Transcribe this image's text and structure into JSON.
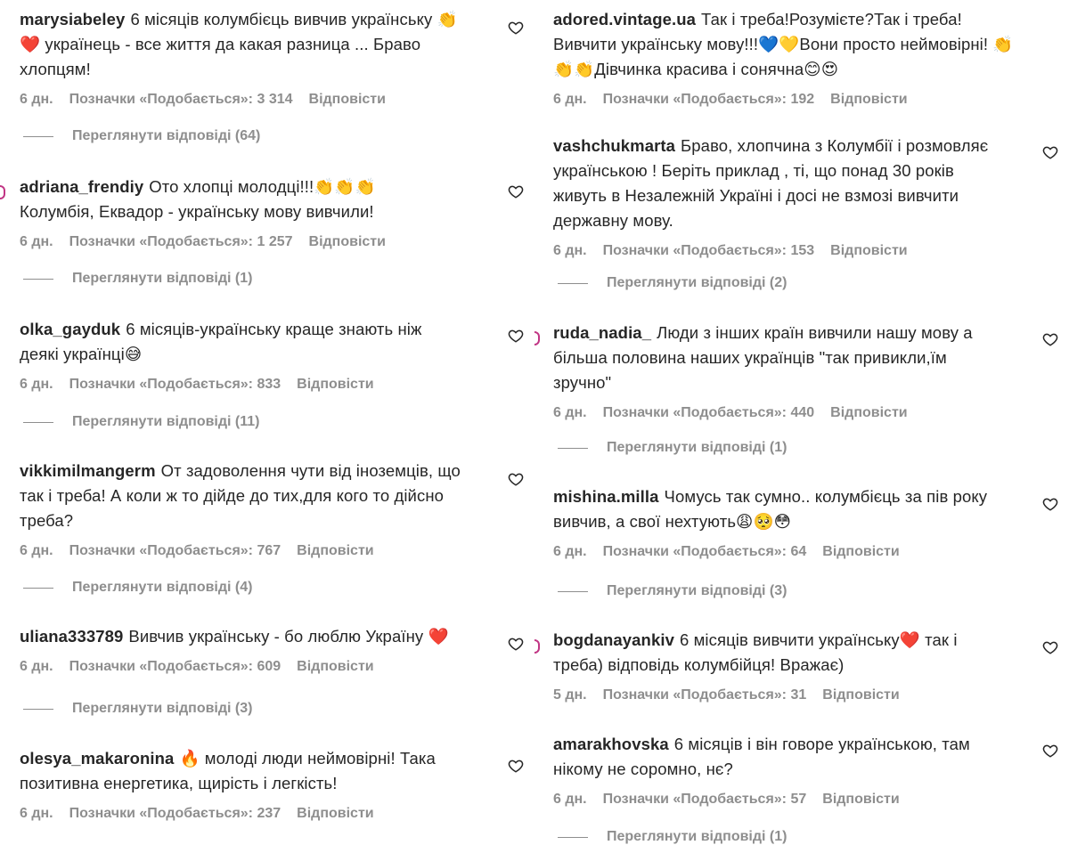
{
  "common": {
    "likes_prefix": "Позначки «Подобається»:",
    "reply_label": "Відповісти",
    "view_replies_prefix": "Переглянути відповіді"
  },
  "left": [
    {
      "username": "marysiabeley",
      "text": "6 місяців колумбієць вивчив українську 👏 ❤️ українець - все життя да какая разница ... Браво хлопцям!",
      "time": "6 дн.",
      "likes": "3 314",
      "replies": "(64)"
    },
    {
      "username": "adriana_frendiy",
      "text": "Ото хлопці молодці!!!👏👏👏 Колумбія, Еквадор - українську мову вивчили!",
      "time": "6 дн.",
      "likes": "1 257",
      "replies": "(1)"
    },
    {
      "username": "olka_gayduk",
      "text": "6 місяців-українську краще знають ніж деякі українці😅",
      "time": "6 дн.",
      "likes": "833",
      "replies": "(11)"
    },
    {
      "username": "vikkimilmangerm",
      "text": "От задоволення чути від іноземців, що так і треба! А коли ж то дійде до тих,для кого то дійсно треба?",
      "time": "6 дн.",
      "likes": "767",
      "replies": "(4)"
    },
    {
      "username": "uliana333789",
      "text": "Вивчив українську - бо люблю Україну ❤️",
      "time": "6 дн.",
      "likes": "609",
      "replies": "(3)"
    },
    {
      "username": "olesya_makaronina",
      "text": "🔥 молоді люди неймовірні! Така позитивна енергетика, щирість і легкість!",
      "time": "6 дн.",
      "likes": "237",
      "replies": ""
    }
  ],
  "right": [
    {
      "username": "adored.vintage.ua",
      "text": "Так і треба!Розумієте?Так і треба! Вивчити українську мову!!!💙💛Вони просто неймовірні! 👏👏👏Дівчинка красива і сонячна😊😍",
      "time": "6 дн.",
      "likes": "192",
      "replies": ""
    },
    {
      "username": "vashchukmarta",
      "text": "Браво, хлопчина з Колумбії і розмовляє українською ! Беріть приклад , ті, що понад 30 років живуть в Незалежній Україні і досі не взмозі вивчити державну мову.",
      "time": "6 дн.",
      "likes": "153",
      "replies": "(2)"
    },
    {
      "username": "ruda_nadia_",
      "text": "Люди з інших країн вивчили нашу мову а більша половина наших українців \"так привикли,їм зручно\"",
      "time": "6 дн.",
      "likes": "440",
      "replies": "(1)"
    },
    {
      "username": "mishina.milla",
      "text": "Чомусь так сумно.. колумбієць за пів року вивчив, а свої нехтують😩🥺😳",
      "time": "6 дн.",
      "likes": "64",
      "replies": "(3)"
    },
    {
      "username": "bogdanayankiv",
      "text": "6 місяців вивчити українську❤️ так і треба) відповідь колумбійця! Вражає)",
      "time": "5 дн.",
      "likes": "31",
      "replies": ""
    },
    {
      "username": "amarakhovska",
      "text": "6 місяців і він говоре українською, там нікому не соромно, нє?",
      "time": "6 дн.",
      "likes": "57",
      "replies": "(1)"
    }
  ],
  "colors": {
    "text": "#262626",
    "secondary": "#8e8e8e",
    "avatar_ring": "#c13584"
  },
  "icons": {
    "like": "heart-outline-icon"
  }
}
